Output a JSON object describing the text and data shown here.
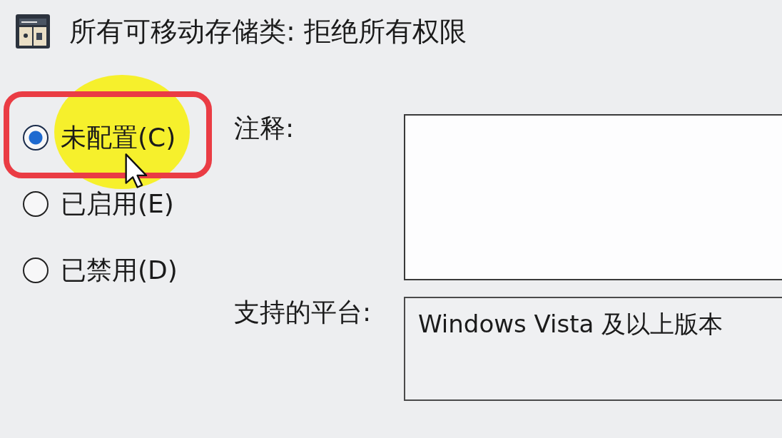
{
  "window": {
    "title": "所有可移动存储类: 拒绝所有权限"
  },
  "options": [
    {
      "label": "未配置(C)",
      "selected": true
    },
    {
      "label": "已启用(E)",
      "selected": false
    },
    {
      "label": "已禁用(D)",
      "selected": false
    }
  ],
  "comment": {
    "label": "注释:"
  },
  "supported_on": {
    "label": "支持的平台:",
    "value": "Windows Vista 及以上版本"
  }
}
